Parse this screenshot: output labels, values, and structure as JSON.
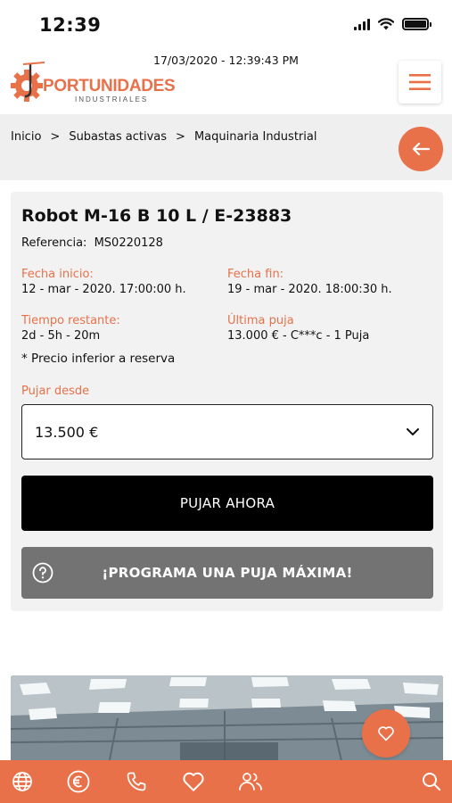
{
  "status_bar": {
    "time": "12:39"
  },
  "header": {
    "datetime": "17/03/2020 - 12:39:43 PM",
    "logo_text": "PORTUNIDADES",
    "logo_subtext": "INDUSTRIALES"
  },
  "breadcrumb": [
    {
      "label": "Inicio"
    },
    {
      "label": "Subastas activas"
    },
    {
      "label": "Maquinaria Industrial"
    }
  ],
  "breadcrumb_separator": ">",
  "product": {
    "title": "Robot M-16 B 10 L / E-23883",
    "reference_label": "Referencia:",
    "reference_value": "MS0220128",
    "start_label": "Fecha inicio:",
    "start_value": "12 - mar - 2020. 17:00:00 h.",
    "end_label": "Fecha fin:",
    "end_value": "19 - mar - 2020. 18:00:30 h.",
    "remaining_label": "Tiempo restante:",
    "remaining_value": "2d - 5h - 20m",
    "last_bid_label": "Última puja",
    "last_bid_value": "13.000 € - C***c - 1 Puja",
    "reserve_note": "* Precio inferior a reserva",
    "bid_from_label": "Pujar desde",
    "bid_amount": "13.500 €",
    "bid_button": "PUJAR AHORA",
    "max_bid_button": "¡PROGRAMA UNA PUJA MÁXIMA!"
  },
  "colors": {
    "accent": "#e8714a",
    "dark_button": "#000000",
    "gray_button": "#737373",
    "card_bg": "#f2f2f2"
  },
  "bottom_nav": [
    {
      "icon": "globe-icon"
    },
    {
      "icon": "euro-icon"
    },
    {
      "icon": "phone-icon"
    },
    {
      "icon": "heart-icon"
    },
    {
      "icon": "users-icon"
    },
    {
      "icon": "search-icon"
    }
  ]
}
